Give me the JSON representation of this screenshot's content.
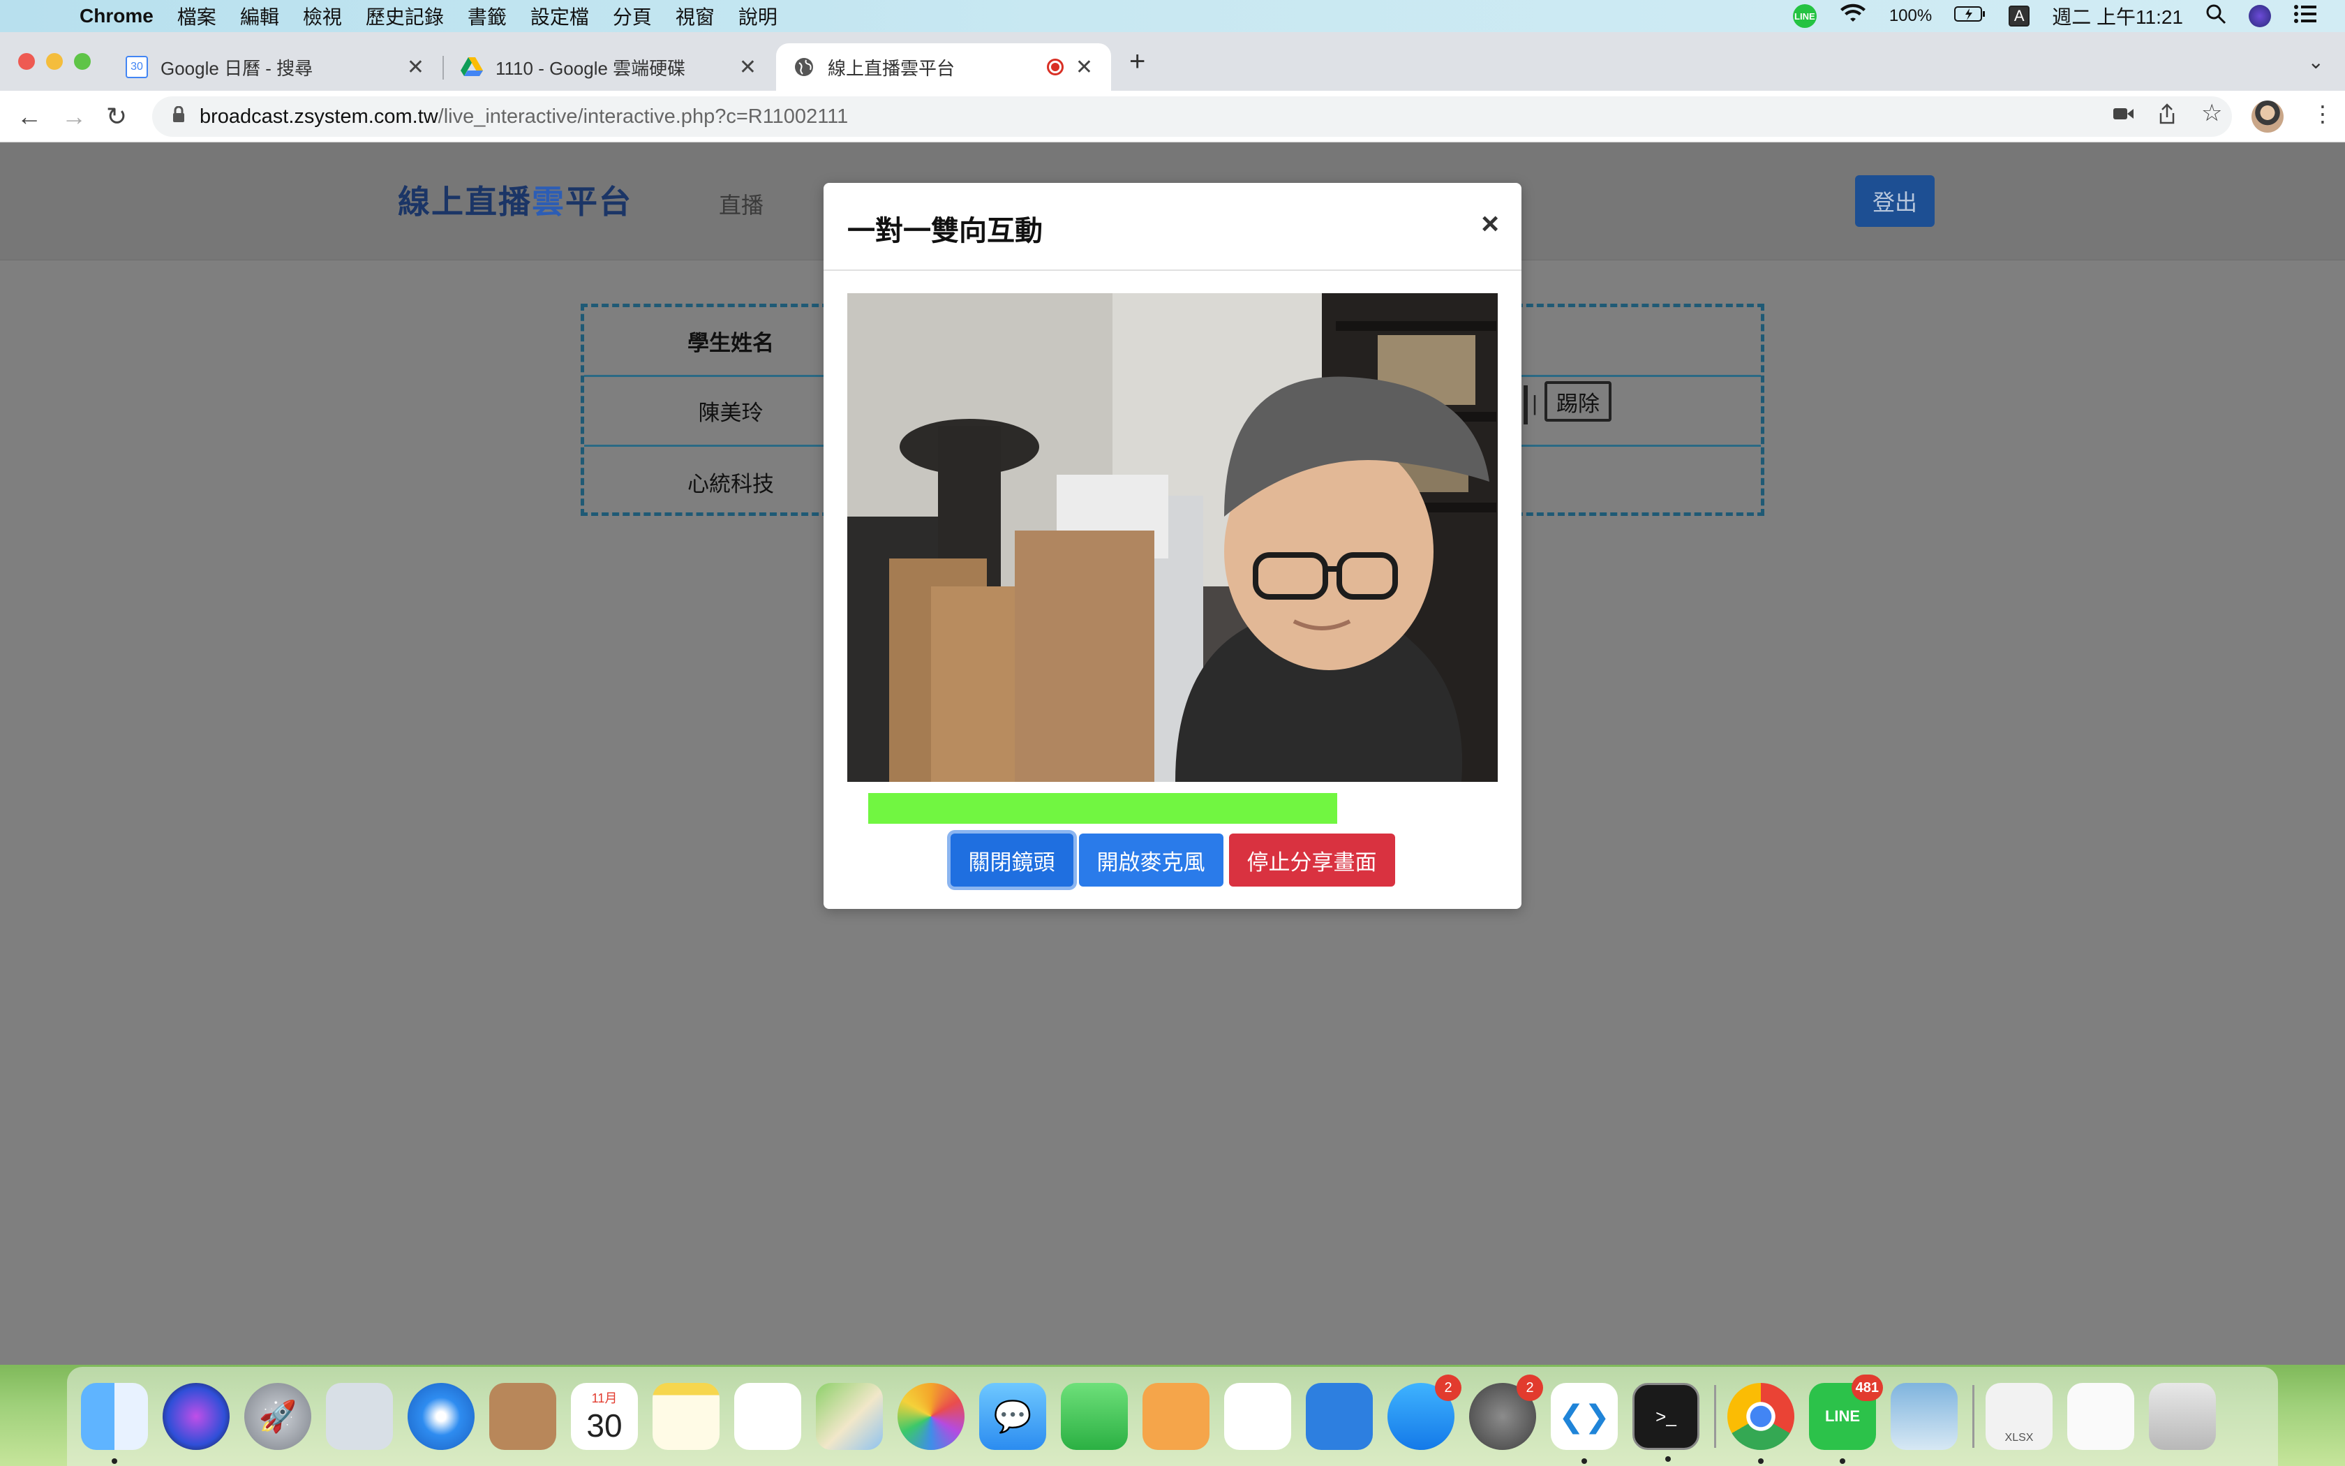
{
  "menubar": {
    "app": "Chrome",
    "items": [
      "檔案",
      "編輯",
      "檢視",
      "歷史記錄",
      "書籤",
      "設定檔",
      "分頁",
      "視窗",
      "說明"
    ],
    "line_label": "LINE",
    "battery": "100%",
    "input_method": "A",
    "clock": "週二 上午11:21"
  },
  "tabs": [
    {
      "title": "Google 日曆 - 搜尋",
      "favicon": "calendar-icon",
      "favicon_text": "30"
    },
    {
      "title": "1110 - Google 雲端硬碟",
      "favicon": "drive-icon"
    },
    {
      "title": "線上直播雲平台",
      "favicon": "globe-icon",
      "active": true
    }
  ],
  "address": {
    "host": "broadcast.zsystem.com.tw",
    "path": "/live_interactive/interactive.php?c=R11002111"
  },
  "page": {
    "brand_pre": "線上直播",
    "brand_cloud": "雲",
    "brand_post": "平台",
    "nav_link": "直播",
    "logout": "登出",
    "table": {
      "header": "學生姓名",
      "rows": [
        "陳美玲",
        "心統科技"
      ],
      "kick_label": "踢除",
      "separator": "|"
    }
  },
  "modal": {
    "title": "一對一雙向互動",
    "close": "×",
    "volume_level": 0.72,
    "buttons": {
      "camera": "關閉鏡頭",
      "mic": "開啟麥克風",
      "share": "停止分享畫面"
    }
  },
  "dock": {
    "calendar_month": "11月",
    "calendar_day": "30",
    "appstore_badge": "2",
    "settings_badge": "2",
    "line_badge": "481",
    "line_label": "LINE",
    "spreadsheet_label": "XLSX"
  },
  "colors": {
    "accent_blue": "#1f6fe0",
    "danger_red": "#d93240",
    "volume_green": "#71f641",
    "brand_navy": "#1b3566"
  }
}
